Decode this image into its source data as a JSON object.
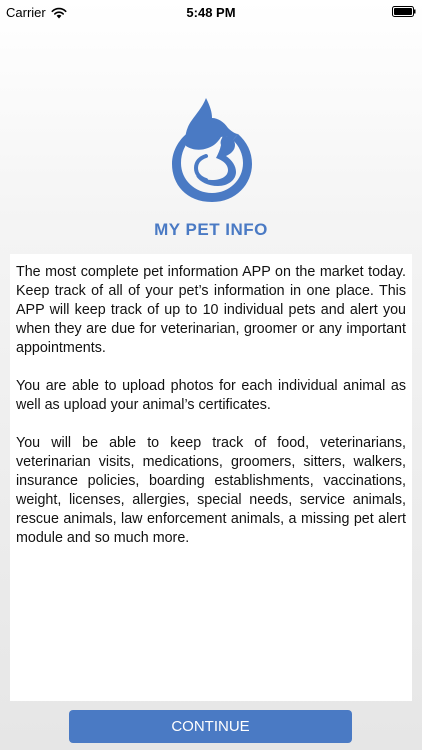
{
  "status_bar": {
    "carrier": "Carrier",
    "time": "5:48 PM",
    "wifi_icon": "wifi-icon",
    "battery_icon": "battery-icon"
  },
  "app": {
    "logo_icon": "pet-cat-dog-logo-icon",
    "title": "MY PET INFO",
    "accent_color": "#4a7ac4"
  },
  "description": {
    "paragraphs": [
      "The most complete pet information APP on the market today. Keep track of all of your pet’s information in one place. This APP will keep track of up to 10 individual pets and alert you when they are due for veterinarian, groomer or any important appointments.",
      "You are able to upload photos for each individual animal as well as upload your animal’s certificates.",
      "You will be able to keep track of food, veterinarians, veterinarian visits, medications, groomers, sitters, walkers, insurance policies, boarding establishments, vaccinations, weight, licenses, allergies, special needs, service animals, rescue animals, law enforcement animals, a missing pet alert module and so much more."
    ]
  },
  "actions": {
    "continue_label": "CONTINUE"
  }
}
